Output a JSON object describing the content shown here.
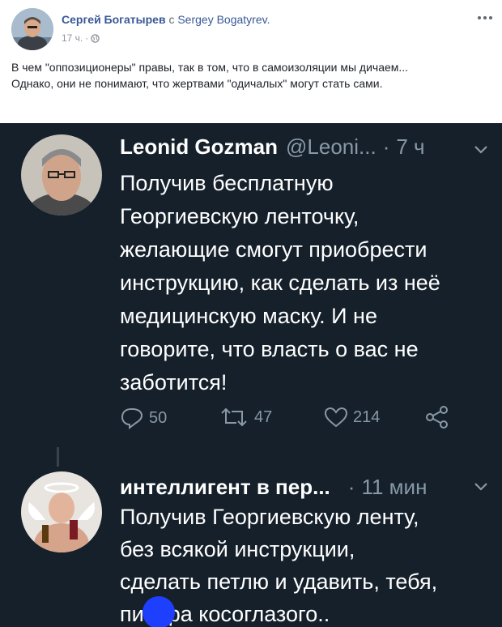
{
  "post": {
    "author": "Сергей Богатырев",
    "with_word": "с",
    "with_name": "Sergey Bogatyrev.",
    "time": "17 ч.",
    "separator": "·",
    "text_line1": "В чем \"оппозиционеры\" правы, так в том, что в самоизоляции мы дичаем...",
    "text_line2": "Однако, они не понимают, что жертвами \"одичалых\" могут стать сами."
  },
  "tweet1": {
    "name": "Leonid Gozman",
    "handle": "@Leoni...",
    "dot": "·",
    "time": "7 ч",
    "body": [
      "Получив бесплатную",
      "Георгиевскую ленточку,",
      "желающие смогут приобрести",
      "инструкцию, как сделать из неё",
      "медицинскую маску. И не",
      "говорите, что власть о вас не",
      "заботится!"
    ],
    "replies": "50",
    "retweets": "47",
    "likes": "214"
  },
  "tweet2": {
    "name": "интеллигент в пер...",
    "dot": "·",
    "time": "11 мин",
    "body": [
      "Получив Георгиевскую ленту,",
      "без всякой инструкции,",
      "сделать петлю и удавить, тебя,",
      "пи    ра косоглазого.."
    ]
  },
  "colors": {
    "fb_link": "#385898",
    "twitter_bg": "#15202b",
    "twitter_muted": "#8899a6",
    "censor_blot": "#1f3fff"
  },
  "icons": [
    "globe-icon",
    "more-options-icon",
    "chevron-down-icon",
    "reply-icon",
    "retweet-icon",
    "like-icon",
    "share-icon"
  ]
}
